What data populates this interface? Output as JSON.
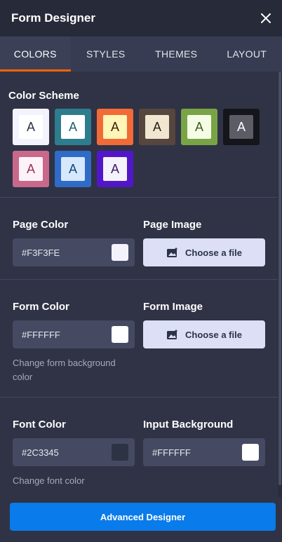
{
  "header": {
    "title": "Form Designer",
    "close_icon": "close-icon"
  },
  "tabs": [
    {
      "label": "COLORS",
      "active": true
    },
    {
      "label": "STYLES",
      "active": false
    },
    {
      "label": "THEMES",
      "active": false
    },
    {
      "label": "LAYOUT",
      "active": false
    }
  ],
  "color_scheme": {
    "title": "Color Scheme",
    "swatches": [
      {
        "letter": "A",
        "outer": "#f3f3fe",
        "inner": "#ffffff",
        "text": "#2c3345"
      },
      {
        "letter": "A",
        "outer": "#2e7d8e",
        "inner": "#ffffff",
        "text": "#1c5f73"
      },
      {
        "letter": "A",
        "outer": "#f26a37",
        "inner": "#fff5b6",
        "text": "#3a1c0c"
      },
      {
        "letter": "A",
        "outer": "#57463e",
        "inner": "#f1e6cf",
        "text": "#2b1d14"
      },
      {
        "letter": "A",
        "outer": "#79a446",
        "inner": "#f5fce6",
        "text": "#3f5e1d"
      },
      {
        "letter": "A",
        "outer": "#15161c",
        "inner": "#5c5c66",
        "text": "#ffffff"
      },
      {
        "letter": "A",
        "outer": "#c8688a",
        "inner": "#fdf3f6",
        "text": "#9b2f5a"
      },
      {
        "letter": "A",
        "outer": "#2f6bc7",
        "inner": "#d6e8fb",
        "text": "#14457e"
      },
      {
        "letter": "A",
        "outer": "#5216c9",
        "inner": "#f4f2fb",
        "text": "#3b1a6a"
      }
    ]
  },
  "page": {
    "color_label": "Page Color",
    "color_value": "#F3F3FE",
    "color_chip": "#F3F3FE",
    "image_label": "Page Image",
    "image_button": "Choose a file"
  },
  "form": {
    "color_label": "Form Color",
    "color_value": "#FFFFFF",
    "color_chip": "#FFFFFF",
    "helper": "Change form background color",
    "image_label": "Form Image",
    "image_button": "Choose a file"
  },
  "font": {
    "color_label": "Font Color",
    "color_value": "#2C3345",
    "color_chip": "#2C3345",
    "helper": "Change font color",
    "bg_label": "Input Background",
    "bg_value": "#FFFFFF",
    "bg_chip": "#FFFFFF"
  },
  "footer": {
    "button": "Advanced Designer"
  },
  "colors": {
    "accent": "#ff6100",
    "primary": "#0a7bea",
    "panel": "#2f3345"
  }
}
